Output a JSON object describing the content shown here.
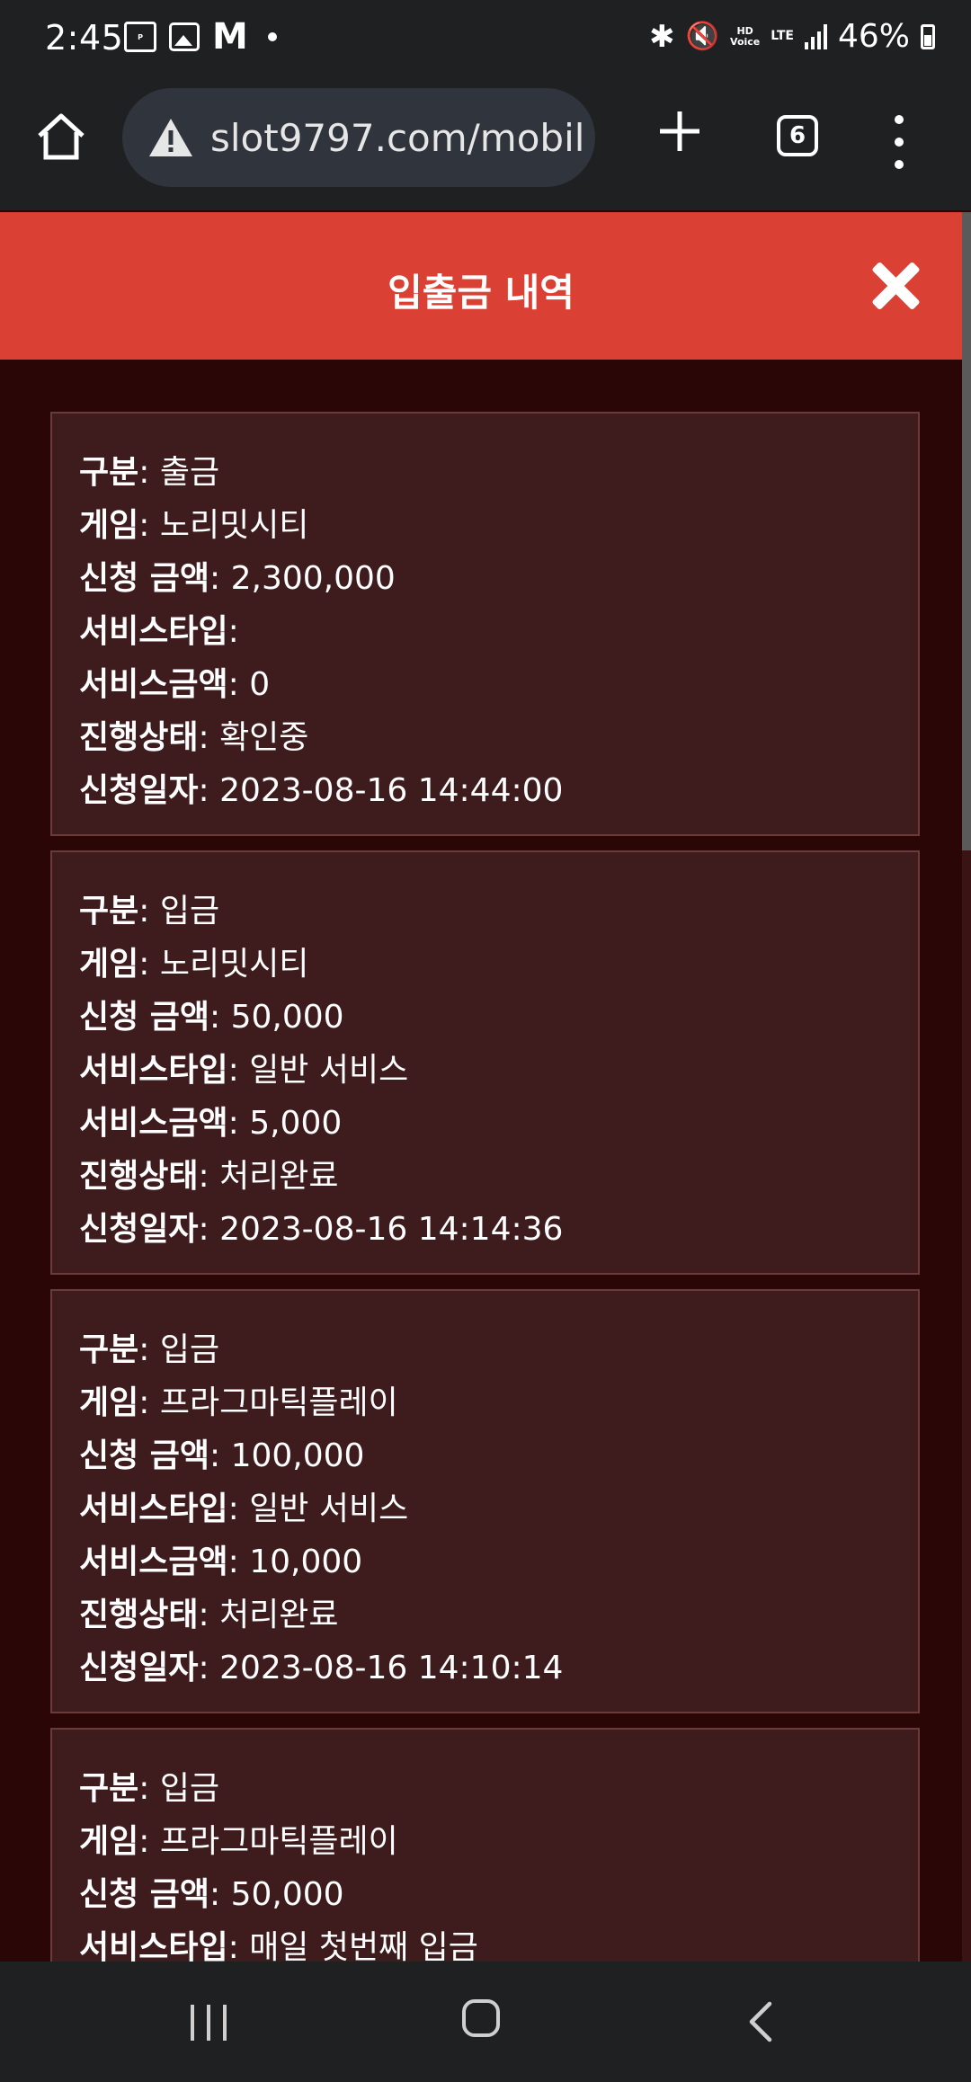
{
  "status_bar": {
    "time": "2:45",
    "hd_voice": "HD\nVoice",
    "network": "LTE",
    "battery": "46%"
  },
  "browser": {
    "url": "slot9797.com/mobil",
    "tab_count": "6"
  },
  "modal": {
    "title": "입출금 내역"
  },
  "labels": {
    "type": "구분",
    "game": "게임",
    "amount": "신청 금액",
    "service_type": "서비스타입",
    "service_amount": "서비스금액",
    "status": "진행상태",
    "date": "신청일자"
  },
  "records": [
    {
      "type": "출금",
      "game": "노리밋시티",
      "amount": "2,300,000",
      "service_type": "",
      "service_amount": "0",
      "status": "확인중",
      "date": "2023-08-16 14:44:00"
    },
    {
      "type": "입금",
      "game": "노리밋시티",
      "amount": "50,000",
      "service_type": "일반 서비스",
      "service_amount": "5,000",
      "status": "처리완료",
      "date": "2023-08-16 14:14:36"
    },
    {
      "type": "입금",
      "game": "프라그마틱플레이",
      "amount": "100,000",
      "service_type": "일반 서비스",
      "service_amount": "10,000",
      "status": "처리완료",
      "date": "2023-08-16 14:10:14"
    },
    {
      "type": "입금",
      "game": "프라그마틱플레이",
      "amount": "50,000",
      "service_type": "매일 첫번째 입금"
    }
  ]
}
